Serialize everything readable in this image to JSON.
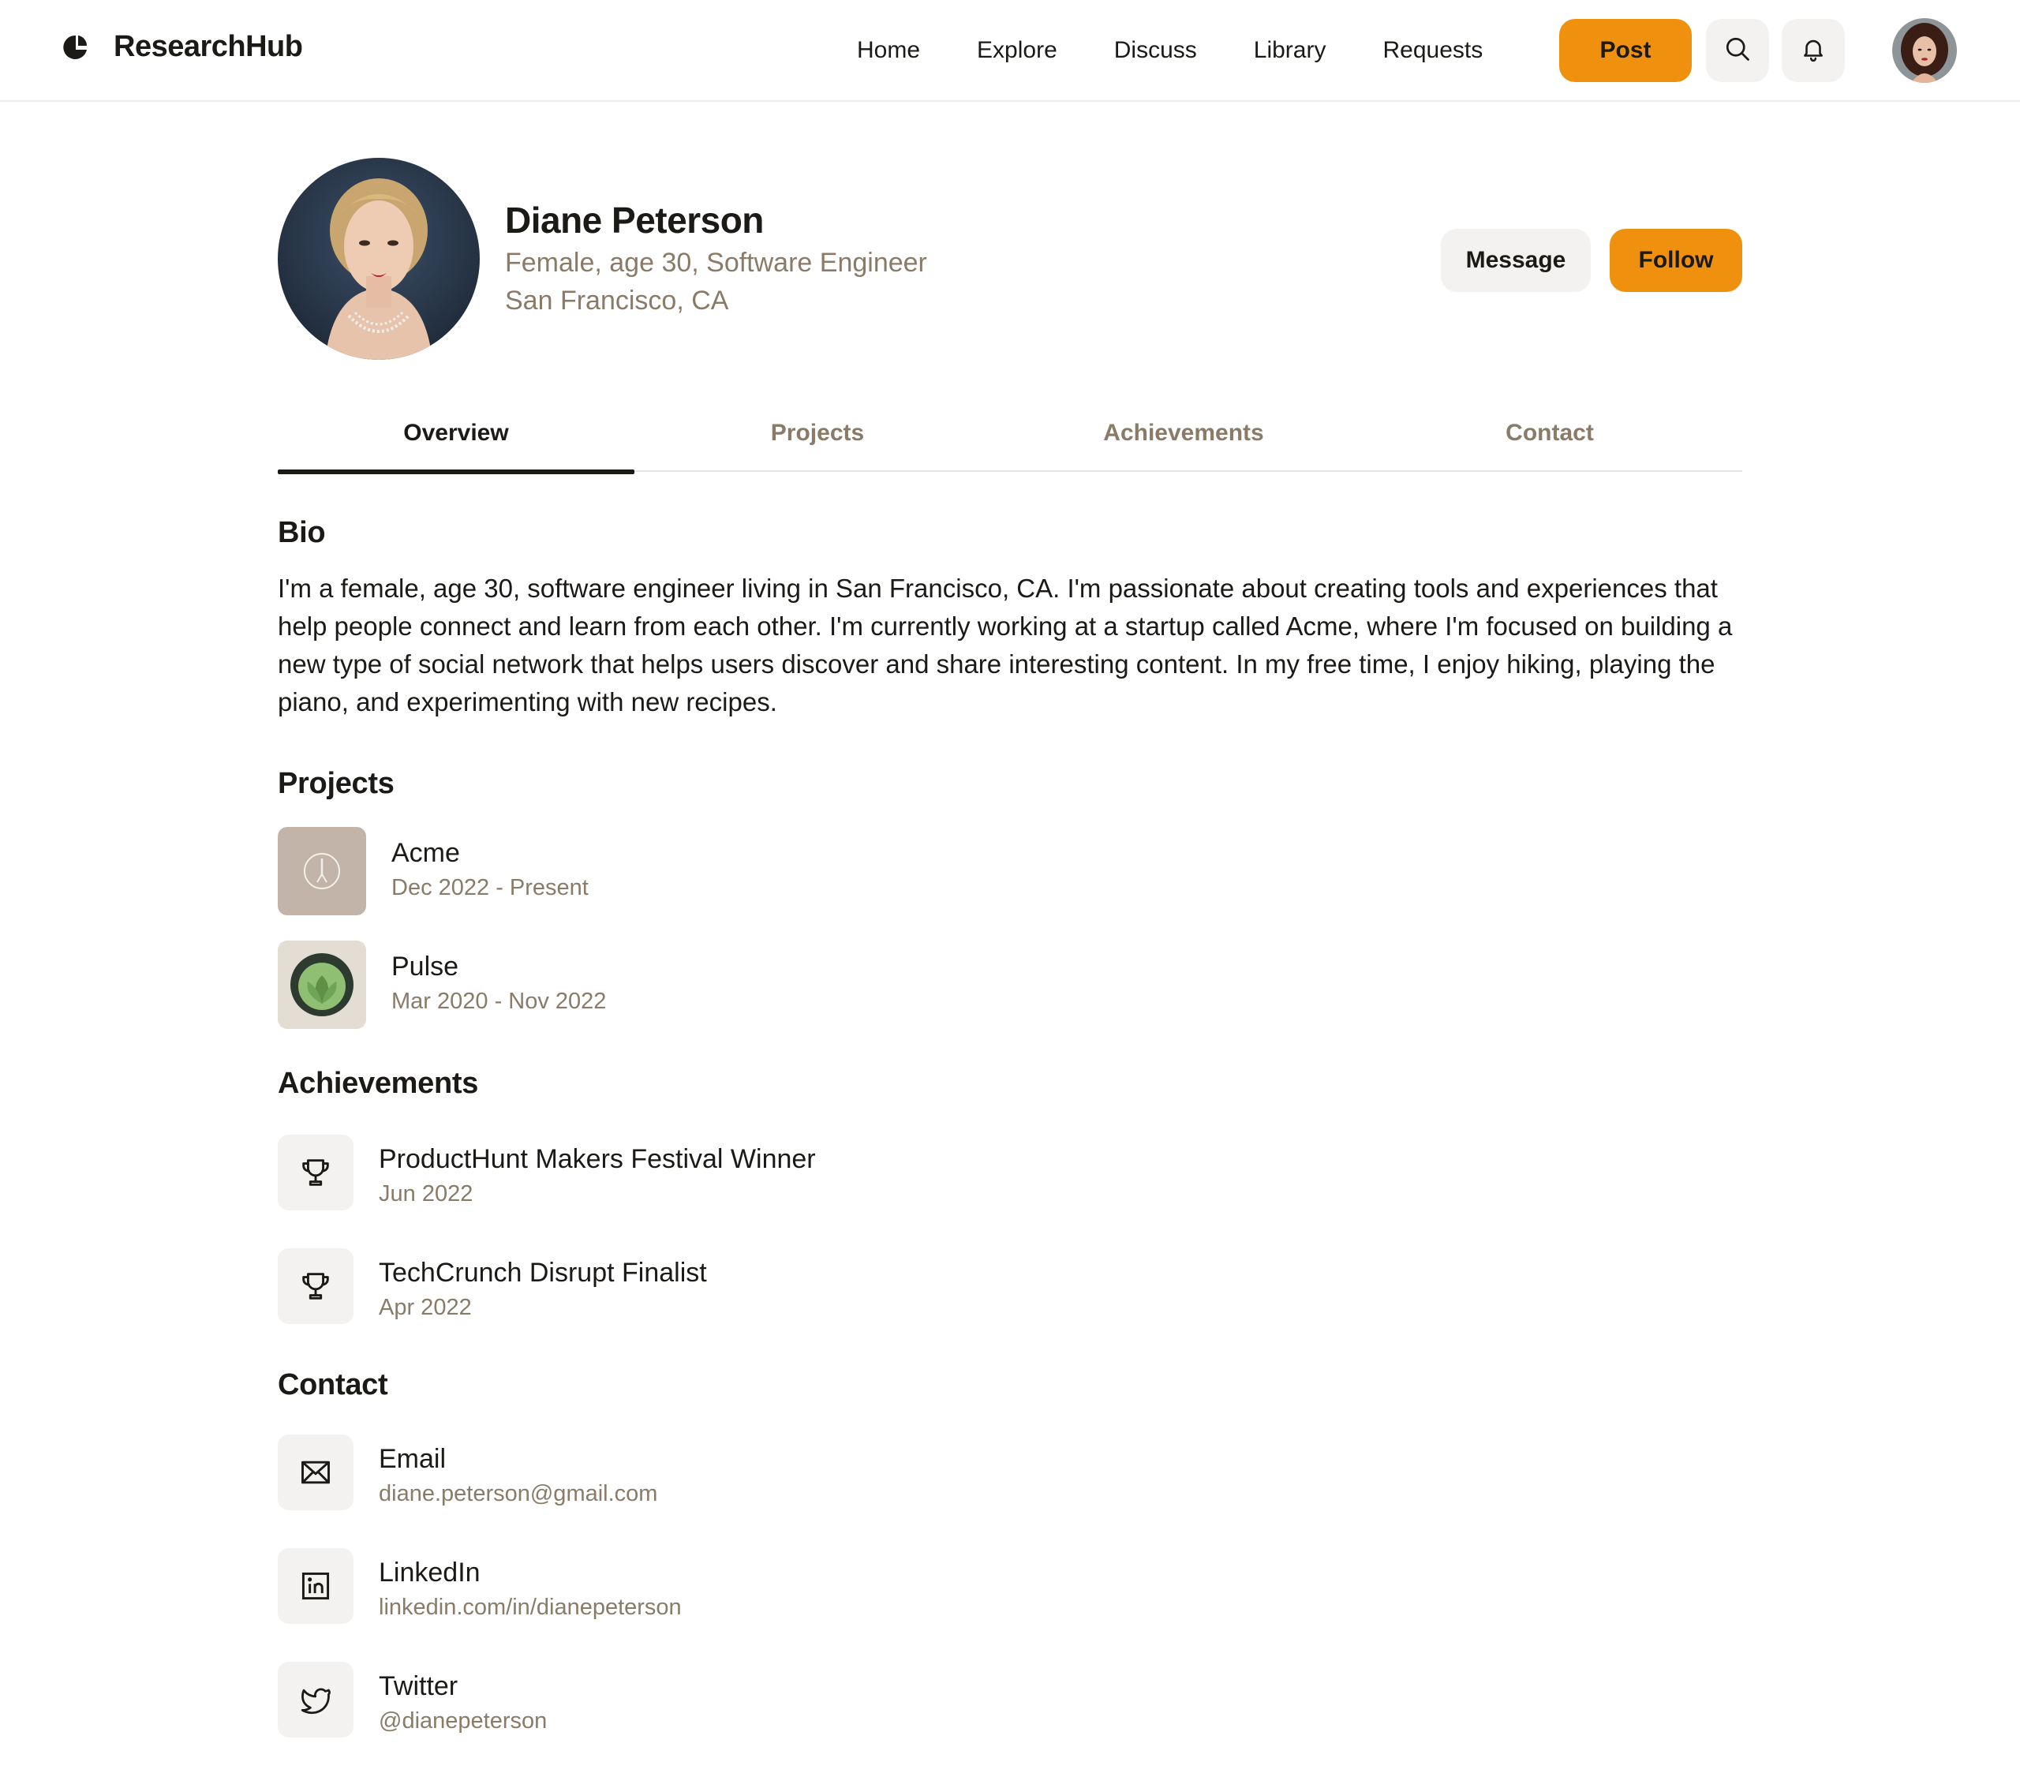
{
  "brand": {
    "name": "ResearchHub",
    "icon": "researchhub-logo"
  },
  "nav": {
    "items": [
      "Home",
      "Explore",
      "Discuss",
      "Library",
      "Requests"
    ],
    "post_label": "Post",
    "search_icon": "search-icon",
    "bell_icon": "bell-icon"
  },
  "colors": {
    "accent": "#f0900f",
    "muted_text": "#8a7b68",
    "surface": "#f3f2f0"
  },
  "profile": {
    "name": "Diane Peterson",
    "subtitle": "Female, age 30, Software Engineer",
    "location": "San Francisco, CA",
    "message_label": "Message",
    "follow_label": "Follow"
  },
  "tabs": [
    "Overview",
    "Projects",
    "Achievements",
    "Contact"
  ],
  "active_tab": "Overview",
  "bio": {
    "title": "Bio",
    "text": "I'm a female, age 30, software engineer living in San Francisco, CA. I'm passionate about creating tools and experiences that help people connect and learn from each other. I'm currently working at a startup called Acme, where I'm focused on building a new type of social network that helps users discover and share interesting content. In my free time, I enjoy hiking, playing the piano, and experimenting with new recipes."
  },
  "projects": {
    "title": "Projects",
    "items": [
      {
        "name": "Acme",
        "dates": "Dec 2022 - Present"
      },
      {
        "name": "Pulse",
        "dates": "Mar 2020 - Nov 2022"
      }
    ]
  },
  "achievements": {
    "title": "Achievements",
    "items": [
      {
        "name": "ProductHunt Makers Festival Winner",
        "date": "Jun 2022",
        "icon": "trophy-icon"
      },
      {
        "name": "TechCrunch Disrupt Finalist",
        "date": "Apr 2022",
        "icon": "trophy-icon"
      }
    ]
  },
  "contact": {
    "title": "Contact",
    "items": [
      {
        "label": "Email",
        "value": "diane.peterson@gmail.com",
        "icon": "mail-icon"
      },
      {
        "label": "LinkedIn",
        "value": "linkedin.com/in/dianepeterson",
        "icon": "linkedin-icon"
      },
      {
        "label": "Twitter",
        "value": "@dianepeterson",
        "icon": "twitter-icon"
      }
    ]
  }
}
